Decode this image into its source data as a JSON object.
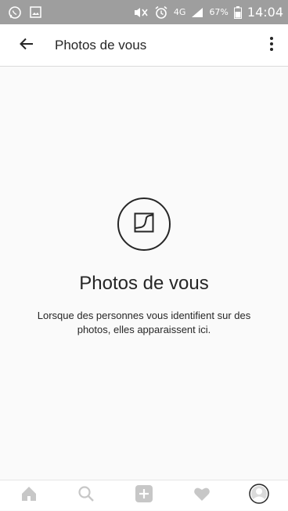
{
  "status_bar": {
    "network": "4G",
    "battery_percent": "67%",
    "time": "14:04",
    "icons": [
      "whatsapp-icon",
      "image-icon",
      "mute-icon",
      "alarm-icon",
      "signal-icon",
      "battery-icon"
    ]
  },
  "header": {
    "title": "Photos de vous",
    "icons": [
      "arrow-left-icon",
      "more-vertical-icon"
    ]
  },
  "empty_state": {
    "icon": "tagged-photo-icon",
    "title": "Photos de vous",
    "description": "Lorsque des personnes vous identifient sur des photos, elles apparaissent ici."
  },
  "bottom_nav": {
    "items": [
      "home-icon",
      "search-icon",
      "add-icon",
      "heart-icon",
      "profile-icon"
    ]
  },
  "colors": {
    "status_bar_bg": "#9e9e9e",
    "text": "#262626",
    "nav_icon": "#c7c7c7",
    "background": "#fafafa"
  }
}
